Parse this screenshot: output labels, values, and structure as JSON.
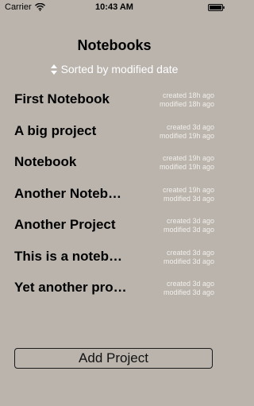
{
  "status_bar": {
    "carrier": "Carrier",
    "time": "10:43 AM",
    "wifi_icon": "wifi-icon",
    "battery_icon": "battery-icon"
  },
  "header": {
    "title": "Notebooks",
    "sort_label": "Sorted by modified date",
    "sort_icon": "sort-updown-icon"
  },
  "notebooks": [
    {
      "name": "First Notebook",
      "created": "created 18h ago",
      "modified": "modified 18h ago"
    },
    {
      "name": "A big project",
      "created": "created 3d ago",
      "modified": "modified 19h ago"
    },
    {
      "name": "Notebook",
      "created": "created 19h ago",
      "modified": "modified 19h ago"
    },
    {
      "name": "Another Noteb…",
      "created": "created 19h ago",
      "modified": "modified 3d ago"
    },
    {
      "name": "Another Project",
      "created": "created 3d ago",
      "modified": "modified 3d ago"
    },
    {
      "name": "This is a noteb…",
      "created": "created 3d ago",
      "modified": "modified 3d ago"
    },
    {
      "name": "Yet another pro…",
      "created": "created 3d ago",
      "modified": "modified 3d ago"
    }
  ],
  "footer": {
    "add_button_label": "Add Project"
  },
  "colors": {
    "background": "#bab4ad",
    "meta_text": "#f2efea",
    "sort_text": "#ffffff"
  }
}
